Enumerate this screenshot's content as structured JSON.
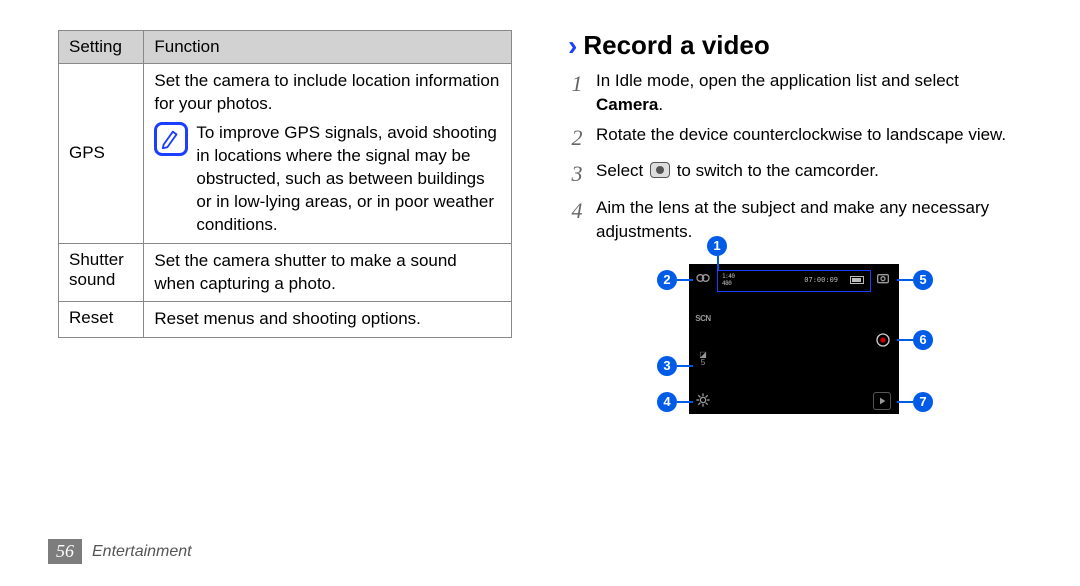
{
  "table": {
    "headers": {
      "setting": "Setting",
      "function": "Function"
    },
    "rows": {
      "gps": {
        "name": "GPS",
        "desc": "Set the camera to include location information for your photos.",
        "note": "To improve GPS signals, avoid shooting in locations where the signal may be obstructed, such as between buildings or in low-lying areas, or in poor weather conditions."
      },
      "shutter": {
        "name": "Shutter sound",
        "desc": "Set the camera shutter to make a sound when capturing a photo."
      },
      "reset": {
        "name": "Reset",
        "desc": "Reset menus and shooting options."
      }
    }
  },
  "section": {
    "title": "Record a video",
    "steps": {
      "s1a": "In Idle mode, open the application list and select ",
      "s1b": "Camera",
      "s1c": ".",
      "s2": "Rotate the device counterclockwise to landscape view.",
      "s3a": "Select ",
      "s3b": " to switch to the camcorder.",
      "s4": "Aim the lens at the subject and make any necessary adjustments."
    },
    "nums": {
      "n1": "1",
      "n2": "2",
      "n3": "3",
      "n4": "4"
    }
  },
  "figure": {
    "callouts": {
      "c1": "1",
      "c2": "2",
      "c3": "3",
      "c4": "4",
      "c5": "5",
      "c6": "6",
      "c7": "7"
    },
    "topbar": {
      "res1": "1:40",
      "res2": "480",
      "time": "07:00:09"
    },
    "left_icons": {
      "scn": "SCN",
      "ev_sym": "◪",
      "ev_val": "5"
    }
  },
  "footer": {
    "page": "56",
    "section": "Entertainment"
  }
}
